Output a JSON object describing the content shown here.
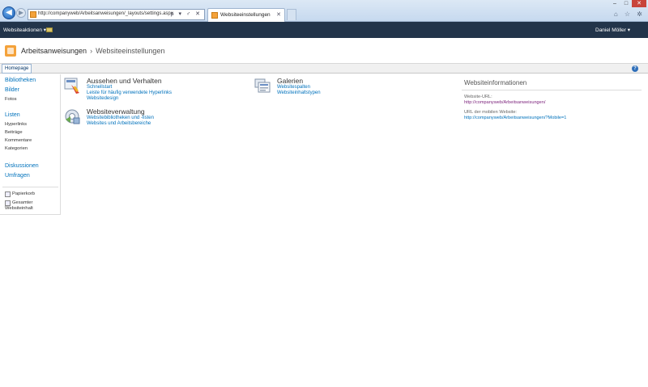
{
  "browser": {
    "address": "http://companyweb/Arbeitsanweisungen/_layouts/settings.aspx",
    "address_tools": "ρ ▾ ♂ ✕",
    "tab_title": "Websiteeinstellungen",
    "tab_close": "✕",
    "window_controls": [
      "–",
      "□",
      "✕"
    ],
    "right_tools": "⌂ ☆ ✲"
  },
  "sharepoint_bar": {
    "actions_label": "Websiteaktionen ▾",
    "user_label": "Daniel Möller ▾"
  },
  "header": {
    "site_name": "Arbeitsanweisungen",
    "separator": "›",
    "page_name": "Websiteeinstellungen"
  },
  "topnav": {
    "home_label": "Homepage",
    "help_glyph": "?"
  },
  "quicklaunch": {
    "libraries": "Bibliotheken",
    "pictures": "Bilder",
    "photos": "Fotos",
    "lists": "Listen",
    "list_items": [
      "Hyperlinks",
      "Beiträge",
      "Kommentare",
      "Kategorien"
    ],
    "discussions": "Diskussionen",
    "surveys": "Umfragen",
    "recycle_bin": "Papierkorb",
    "all_content_1": "Gesamter",
    "all_content_2": "Websiteinhalt"
  },
  "sections": {
    "look_feel": {
      "title": "Aussehen und Verhalten",
      "links": [
        "Schnellstart",
        "Leiste für häufig verwendete Hyperlinks",
        "Websitedesign"
      ]
    },
    "galleries": {
      "title": "Galerien",
      "links": [
        "Websitespalten",
        "Websiteinhaltstypen"
      ]
    },
    "admin": {
      "title": "Websiteverwaltung",
      "links": [
        "Websitebibliotheken und -listen",
        "Websites und Arbeitsbereiche"
      ]
    }
  },
  "site_info": {
    "title": "Websiteinformationen",
    "url_label": "Website-URL:",
    "url_value": "http://companyweb/Arbeitsanweisungen/",
    "mobile_label": "URL der mobilen Website:",
    "mobile_value": "http://companyweb/Arbeitsanweisungen/?Mobile=1"
  },
  "colors": {
    "link": "#0072bc",
    "visited": "#7a1f7a",
    "bar": "#22344a",
    "accent": "#f4a23a"
  }
}
